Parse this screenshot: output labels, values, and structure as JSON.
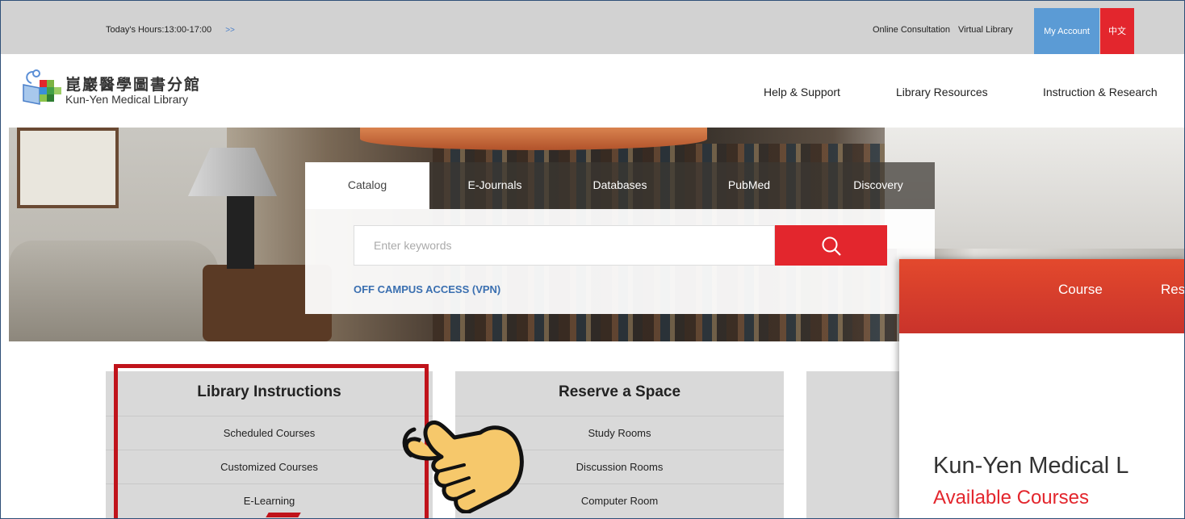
{
  "topbar": {
    "hours": "Today's Hours:13:00-17:00",
    "more": ">>",
    "links": [
      "Online Consultation",
      "Virtual Library"
    ],
    "my_account": "My Account",
    "lang": "中文"
  },
  "header": {
    "logo_zh": "崑巖醫學圖書分館",
    "logo_en": "Kun-Yen Medical Library",
    "nav": [
      "Help & Support",
      "Library Resources",
      "Instruction & Research"
    ]
  },
  "search": {
    "tabs": [
      "Catalog",
      "E-Journals",
      "Databases",
      "PubMed",
      "Discovery"
    ],
    "placeholder": "Enter keywords",
    "vpn": "OFF CAMPUS ACCESS (VPN)"
  },
  "cards": [
    {
      "title": "Library Instructions",
      "items": [
        "Scheduled Courses",
        "Customized Courses",
        "E-Learning"
      ]
    },
    {
      "title": "Reserve a Space",
      "items": [
        "Study Rooms",
        "Discussion Rooms",
        "Computer Room"
      ]
    }
  ],
  "overlay": {
    "tabs": [
      "Course",
      "Res"
    ],
    "title": "Kun-Yen Medical L",
    "subtitle": "Available Courses"
  },
  "colors": {
    "accent": "#e3262d",
    "account": "#5b9bd5",
    "link": "#3a6fb0",
    "highlight": "#c0131b"
  }
}
